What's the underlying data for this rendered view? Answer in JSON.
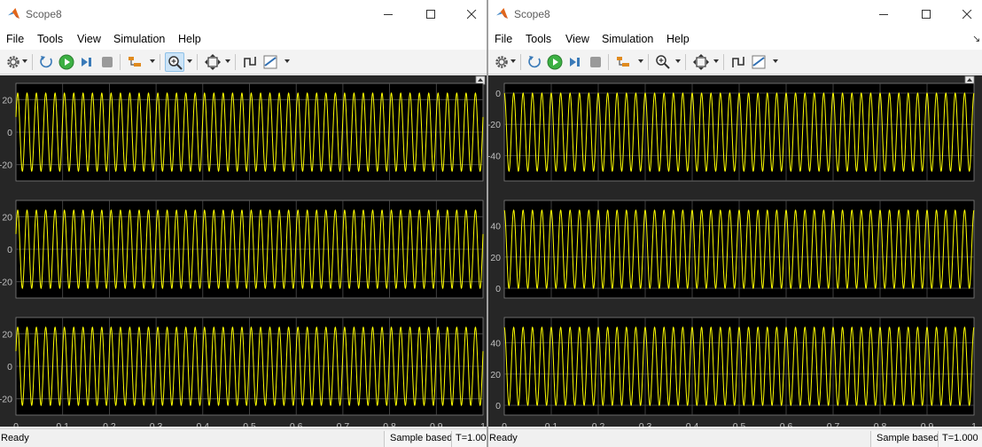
{
  "windows": [
    {
      "title": "Scope8",
      "menu": [
        "File",
        "Tools",
        "View",
        "Simulation",
        "Help"
      ],
      "status": {
        "text": "Ready",
        "sample_mode": "Sample based",
        "time": "T=1.00"
      },
      "panels": [
        {
          "yticks": [
            "20",
            "0",
            "-20"
          ],
          "amplitude": 24,
          "offset": 0
        },
        {
          "yticks": [
            "20",
            "0",
            "-20"
          ],
          "amplitude": 24,
          "offset": 0
        },
        {
          "yticks": [
            "20",
            "0",
            "-20"
          ],
          "amplitude": 24,
          "offset": 0
        }
      ],
      "xticks": [
        "0",
        "0.1",
        "0.2",
        "0.3",
        "0.4",
        "0.5",
        "0.6",
        "0.7",
        "0.8",
        "0.9",
        "1"
      ]
    },
    {
      "title": "Scope8",
      "menu": [
        "File",
        "Tools",
        "View",
        "Simulation",
        "Help"
      ],
      "status": {
        "text": "Ready",
        "sample_mode": "Sample based",
        "time": "T=1.000"
      },
      "panels": [
        {
          "yticks": [
            "0",
            "-20",
            "-40"
          ],
          "amplitude": 25,
          "offset": -25
        },
        {
          "yticks": [
            "40",
            "20",
            "0"
          ],
          "amplitude": 25,
          "offset": 25
        },
        {
          "yticks": [
            "40",
            "20",
            "0"
          ],
          "amplitude": 25,
          "offset": 25
        }
      ],
      "xticks": [
        "0",
        "0.1",
        "0.2",
        "0.3",
        "0.4",
        "0.5",
        "0.6",
        "0.7",
        "0.8",
        "0.9",
        "1"
      ]
    }
  ],
  "chart_data": [
    {
      "type": "line",
      "x_range": [
        0,
        1
      ],
      "series": [
        {
          "values_description_kind": "sine",
          "frequency_cycles": 50,
          "amplitude": 24,
          "offset": 0
        }
      ],
      "ylim": [
        -30,
        30
      ]
    },
    {
      "type": "line",
      "x_range": [
        0,
        1
      ],
      "series": [
        {
          "frequency_cycles": 50,
          "amplitude": 24,
          "offset": 0
        }
      ],
      "ylim": [
        -30,
        30
      ]
    },
    {
      "type": "line",
      "x_range": [
        0,
        1
      ],
      "series": [
        {
          "frequency_cycles": 50,
          "amplitude": 24,
          "offset": 0
        }
      ],
      "ylim": [
        -30,
        30
      ]
    },
    {
      "type": "line",
      "x_range": [
        0,
        1
      ],
      "series": [
        {
          "frequency_cycles": 50,
          "amplitude": 25,
          "offset": -25
        }
      ],
      "ylim": [
        -55,
        5
      ]
    },
    {
      "type": "line",
      "x_range": [
        0,
        1
      ],
      "series": [
        {
          "frequency_cycles": 50,
          "amplitude": 25,
          "offset": 25
        }
      ],
      "ylim": [
        -5,
        55
      ]
    },
    {
      "type": "line",
      "x_range": [
        0,
        1
      ],
      "series": [
        {
          "frequency_cycles": 50,
          "amplitude": 25,
          "offset": 25
        }
      ],
      "ylim": [
        -5,
        55
      ]
    }
  ],
  "colors": {
    "trace": "#ffff00",
    "axes_bg": "#000000",
    "panel_bg": "#262626",
    "grid": "#505050",
    "tick_text": "#c0c0c0"
  },
  "icons": [
    "settings-gear-icon",
    "step-back-icon",
    "run-icon",
    "step-forward-icon",
    "stop-icon",
    "signal-select-icon",
    "zoom-in-icon",
    "autoscale-icon",
    "triggers-icon",
    "measurements-icon",
    "undock-icon",
    "matlab-logo-icon"
  ]
}
